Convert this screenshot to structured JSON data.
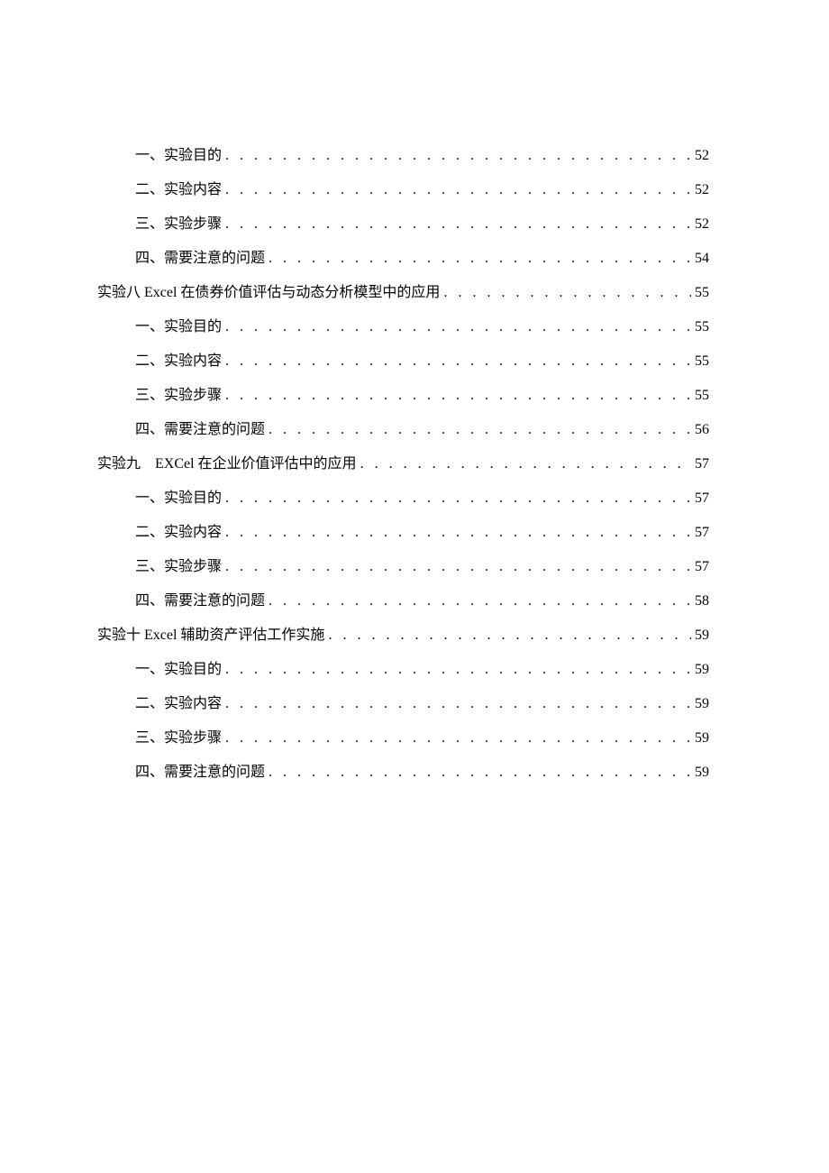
{
  "toc": {
    "entries": [
      {
        "level": 2,
        "title": "一、实验目的",
        "page": "52"
      },
      {
        "level": 2,
        "title": "二、实验内容",
        "page": "52"
      },
      {
        "level": 2,
        "title": "三、实验步骤",
        "page": "52"
      },
      {
        "level": 2,
        "title": "四、需要注意的问题",
        "page": "54"
      },
      {
        "level": 1,
        "title": "实验八 Excel 在债券价值评估与动态分析模型中的应用",
        "page": "55"
      },
      {
        "level": 2,
        "title": "一、实验目的",
        "page": "55"
      },
      {
        "level": 2,
        "title": "二、实验内容",
        "page": "55"
      },
      {
        "level": 2,
        "title": "三、实验步骤",
        "page": "55"
      },
      {
        "level": 2,
        "title": "四、需要注意的问题",
        "page": "56"
      },
      {
        "level": 1,
        "title": "实验九　EXCel 在企业价值评估中的应用",
        "page": "57"
      },
      {
        "level": 2,
        "title": "一、实验目的",
        "page": "57"
      },
      {
        "level": 2,
        "title": "二、实验内容",
        "page": "57"
      },
      {
        "level": 2,
        "title": "三、实验步骤",
        "page": "57"
      },
      {
        "level": 2,
        "title": "四、需要注意的问题",
        "page": "58"
      },
      {
        "level": 1,
        "title": "实验十 Excel 辅助资产评估工作实施",
        "page": "59"
      },
      {
        "level": 2,
        "title": "一、实验目的",
        "page": "59"
      },
      {
        "level": 2,
        "title": "二、实验内容",
        "page": "59"
      },
      {
        "level": 2,
        "title": "三、实验步骤",
        "page": "59"
      },
      {
        "level": 2,
        "title": "四、需要注意的问题",
        "page": "59"
      }
    ]
  }
}
